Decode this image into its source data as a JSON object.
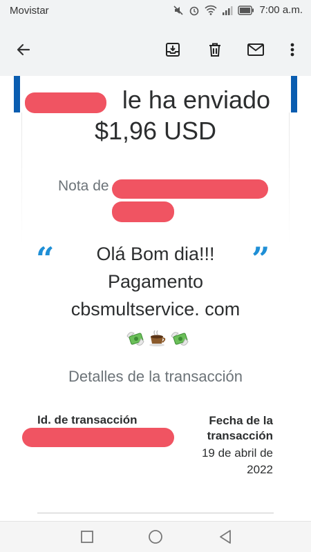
{
  "status_bar": {
    "carrier": "Movistar",
    "time": "7:00 a.m.",
    "icons": [
      "mute-icon",
      "alarm-icon",
      "wifi-icon",
      "signal-icon",
      "battery-icon"
    ]
  },
  "toolbar": {
    "icons": [
      "back-arrow-icon",
      "archive-icon",
      "delete-icon",
      "mail-icon",
      "more-icon"
    ]
  },
  "email": {
    "headline_line1": "le ha enviado",
    "amount": "$1,96 USD",
    "note_label": "Nota de",
    "message_text": "Olá Bom dia!!! Pagamento cbsmultservice. com",
    "message_emojis": [
      "money-with-wings-icon",
      "hot-beverage-icon",
      "money-with-wings-icon"
    ],
    "details_title": "Detalles de la transacción",
    "tx_id_label": "Id. de transacción",
    "tx_date_label": "Fecha de la transacción",
    "tx_date_value": "19 de abril de 2022"
  },
  "colors": {
    "accent_blue": "#0a5db0",
    "quote_blue": "#1f8fd6",
    "redaction": "#ef4b5a",
    "text_dark": "#2c2e2f",
    "text_muted": "#6c7378"
  }
}
